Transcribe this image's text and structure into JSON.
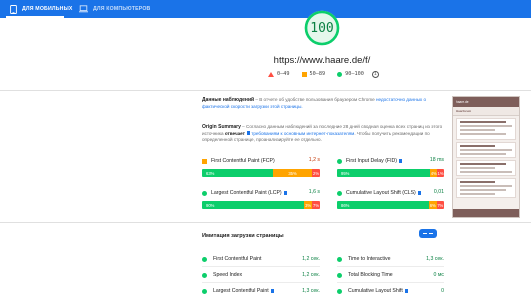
{
  "tabs": {
    "mobile": "ДЛЯ МОБИЛЬНЫХ",
    "desktop": "ДЛЯ КОМПЬЮТЕРОВ"
  },
  "score": {
    "value": "100",
    "fraction": 1.0
  },
  "url": "https://www.haare.de/f/",
  "legend": {
    "poor": "0–49",
    "average": "50–89",
    "good": "90–100",
    "info_icon": "info-icon"
  },
  "field_data": {
    "heading": "Данные наблюдений",
    "intro_a": " – В отчете об удобстве пользования браузером Chrome ",
    "intro_b": "недостаточно данных о фактической скорости загрузки этой страницы."
  },
  "origin": {
    "heading": "Origin Summary",
    "text_a": " – Согласно данным наблюдений за последние 28 дней сводная оценка всех страниц из этого источника ",
    "status": "отвечает",
    "text_b": " требованиям к основным интернет-показателям",
    "text_c": ". Чтобы получить рекомендации по определенной странице, проанализируйте ее отдельно.",
    "metrics": [
      {
        "label": "First Contentful Paint (FCP)",
        "value": "1,2 s",
        "rating": "orange",
        "flag": false,
        "dist": {
          "good": 63,
          "avg": 35,
          "poor": 2
        },
        "labels": [
          "63%",
          "35%",
          "2%"
        ]
      },
      {
        "label": "First Input Delay (FID)",
        "value": "18 ms",
        "rating": "green",
        "flag": true,
        "dist": {
          "good": 95,
          "avg": 4,
          "poor": 1
        },
        "labels": [
          "95%",
          "4%",
          "1%"
        ]
      },
      {
        "label": "Largest Contentful Paint (LCP)",
        "value": "1,6 s",
        "rating": "green",
        "flag": true,
        "dist": {
          "good": 90,
          "avg": 3,
          "poor": 7
        },
        "labels": [
          "90%",
          "3%",
          "7%"
        ]
      },
      {
        "label": "Cumulative Layout Shift (CLS)",
        "value": "0,01",
        "rating": "green",
        "flag": true,
        "dist": {
          "good": 86,
          "avg": 6,
          "poor": 7
        },
        "labels": [
          "86%",
          "6%",
          "7%"
        ]
      }
    ]
  },
  "lab": {
    "heading": "Имитация загрузки страницы",
    "rows": [
      {
        "label": "First Contentful Paint",
        "value": "1,2 сек.",
        "flag": false
      },
      {
        "label": "Time to Interactive",
        "value": "1,3 сек.",
        "flag": false
      },
      {
        "label": "Speed Index",
        "value": "1,2 сек.",
        "flag": false
      },
      {
        "label": "Total Blocking Time",
        "value": "0 мс",
        "flag": false
      },
      {
        "label": "Largest Contentful Paint",
        "value": "1,3 сек.",
        "flag": true
      },
      {
        "label": "Cumulative Layout Shift",
        "value": "0",
        "flag": true
      }
    ]
  },
  "thumbnail": {
    "brand": "haare.de",
    "title": "Haarforum"
  },
  "colors": {
    "accent": "#1a73e8",
    "good": "#0cce6b",
    "average": "#ffa400",
    "poor": "#ff4e42"
  }
}
